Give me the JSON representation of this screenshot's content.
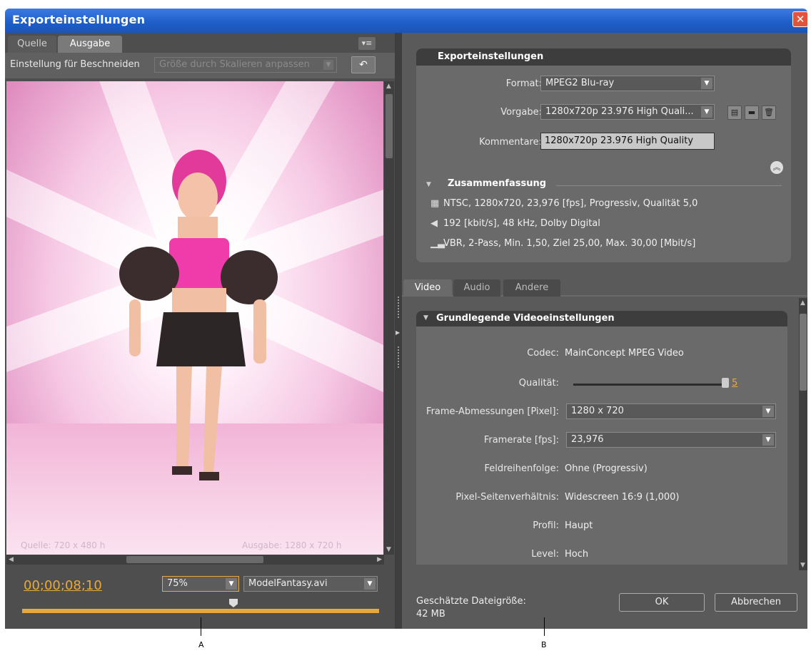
{
  "window": {
    "title": "Exporteinstellungen",
    "close_icon": "close-icon"
  },
  "left_panel": {
    "tabs": [
      {
        "label": "Quelle",
        "active": false
      },
      {
        "label": "Ausgabe",
        "active": true
      }
    ],
    "crop": {
      "label": "Einstellung für Beschneiden",
      "select_value": "Größe durch Skalieren anpassen"
    },
    "preview": {
      "source_info": "Quelle: 720 x 480 h",
      "output_info": "Ausgabe: 1280 x 720 h"
    },
    "timecode": "00;00;08;10",
    "zoom": "75%",
    "file": "ModelFantasy.avi"
  },
  "export_settings": {
    "title": "Exporteinstellungen",
    "format_label": "Format:",
    "format_value": "MPEG2 Blu-ray",
    "preset_label": "Vorgabe:",
    "preset_value": "1280x720p 23.976 High Quali...",
    "comments_label": "Kommentare:",
    "comments_value": "1280x720p 23.976 High Quality",
    "summary_title": "Zusammenfassung",
    "summary": [
      {
        "icon": "film-icon",
        "text": "NTSC, 1280x720, 23,976 [fps], Progressiv, Qualität 5,0"
      },
      {
        "icon": "speaker-icon",
        "text": "192 [kbit/s], 48 kHz, Dolby Digital"
      },
      {
        "icon": "bitrate-icon",
        "text": "VBR, 2-Pass, Min. 1,50, Ziel 25,00, Max. 30,00 [Mbit/s]"
      }
    ]
  },
  "settings_tabs": [
    {
      "label": "Video",
      "active": true
    },
    {
      "label": "Audio",
      "active": false
    },
    {
      "label": "Andere",
      "active": false
    }
  ],
  "video": {
    "section_title": "Grundlegende Videoeinstellungen",
    "codec_label": "Codec:",
    "codec_value": "MainConcept MPEG Video",
    "quality_label": "Qualität:",
    "quality_value": "5",
    "quality_level": 1.0,
    "frame_label": "Frame-Abmessungen [Pixel]:",
    "frame_value": "1280 x 720",
    "framerate_label": "Framerate [fps]:",
    "framerate_value": "23,976",
    "field_label": "Feldreihenfolge:",
    "field_value": "Ohne (Progressiv)",
    "par_label": "Pixel-Seitenverhältnis:",
    "par_value": "Widescreen 16:9 (1,000)",
    "profile_label": "Profil:",
    "profile_value": "Haupt",
    "level_label": "Level:",
    "level_value": "Hoch"
  },
  "footer": {
    "estimate_label": "Geschätzte Dateigröße:",
    "estimate_value": "42 MB",
    "ok": "OK",
    "cancel": "Abbrechen"
  },
  "callouts": {
    "a": "A",
    "b": "B"
  },
  "colors": {
    "accent": "#e8a93c",
    "titlebar": "#2a66d0",
    "panel": "#5a5a5a"
  }
}
